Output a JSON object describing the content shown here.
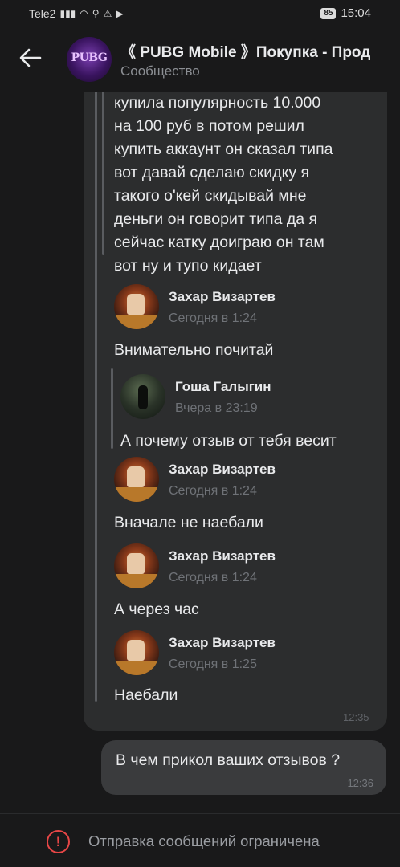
{
  "status_bar": {
    "carrier": "Tele2",
    "battery": "85",
    "time": "15:04"
  },
  "header": {
    "title": "《 PUBG Mobile 》Покупка - Прод",
    "subtitle": "Сообщество",
    "avatar_text": "PUBG"
  },
  "messages": {
    "quoted_text": [
      "купила популярность 10.000",
      "на 100 руб в потом решил",
      "купить аккаунт он сказал типа",
      "вот давай сделаю скидку я",
      "такого о'кей скидывай мне",
      "деньги он говорит типа да я",
      "сейчас катку доиграю он там",
      "вот ну и тупо кидает"
    ],
    "fwd1": {
      "author": "Захар Визартев",
      "time": "Сегодня в 1:24",
      "text": "Внимательно почитай"
    },
    "fwd_nested": {
      "author": "Гоша Галыгин",
      "time": "Вчера в 23:19",
      "text": "А почему отзыв от тебя весит"
    },
    "fwd2": {
      "author": "Захар Визартев",
      "time": "Сегодня в 1:24",
      "text": "Вначале не наебали"
    },
    "fwd3": {
      "author": "Захар Визартев",
      "time": "Сегодня в 1:24",
      "text": "А через час"
    },
    "fwd4": {
      "author": "Захар Визартев",
      "time": "Сегодня в 1:25",
      "text": "Наебали"
    },
    "incoming_time": "12:35",
    "outgoing": {
      "text": "В чем прикол ваших отзывов ?",
      "time": "12:36"
    }
  },
  "bottom": {
    "restricted_text": "Отправка сообщений ограничена"
  },
  "colors": {
    "background": "#19191a",
    "bubble_in": "#2c2d2e",
    "bubble_out": "#3a3b3d",
    "warning": "#e64646"
  }
}
